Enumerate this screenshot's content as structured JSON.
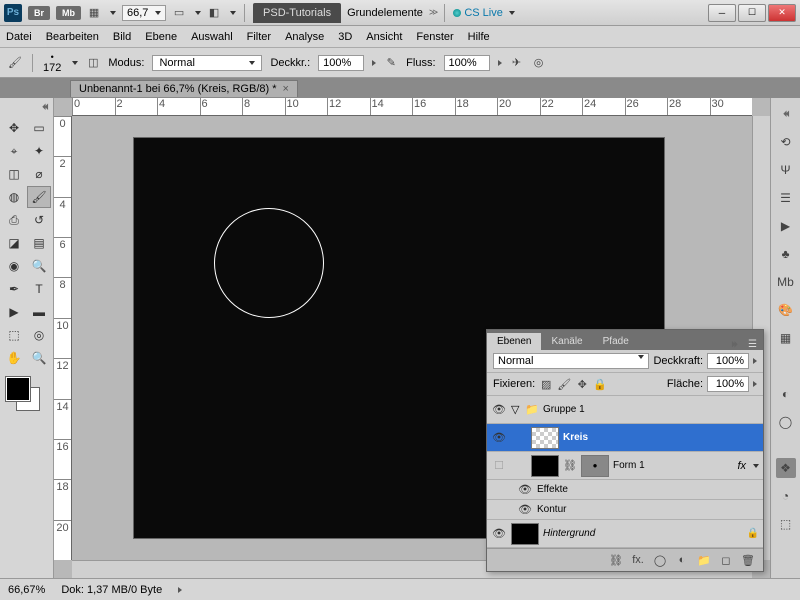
{
  "titlebar": {
    "ps": "Ps",
    "br": "Br",
    "mb": "Mb",
    "zoom": "66,7",
    "workspace1": "PSD-Tutorials",
    "workspace2": "Grundelemente",
    "cslive": "CS Live"
  },
  "menu": [
    "Datei",
    "Bearbeiten",
    "Bild",
    "Ebene",
    "Auswahl",
    "Filter",
    "Analyse",
    "3D",
    "Ansicht",
    "Fenster",
    "Hilfe"
  ],
  "options": {
    "brush_size": "172",
    "mode_label": "Modus:",
    "mode_value": "Normal",
    "opacity_label": "Deckkr.:",
    "opacity_value": "100%",
    "flow_label": "Fluss:",
    "flow_value": "100%"
  },
  "doc_tab": "Unbenannt-1 bei 66,7% (Kreis, RGB/8) *",
  "ruler_h": [
    "0",
    "2",
    "4",
    "6",
    "8",
    "10",
    "12",
    "14",
    "16",
    "18",
    "20",
    "22",
    "24",
    "26",
    "28",
    "30"
  ],
  "ruler_v": [
    "0",
    "2",
    "4",
    "6",
    "8",
    "10",
    "12",
    "14",
    "16",
    "18",
    "20"
  ],
  "status": {
    "zoom": "66,67%",
    "doc": "Dok: 1,37 MB/0 Byte"
  },
  "panel": {
    "tabs": [
      "Ebenen",
      "Kanäle",
      "Pfade"
    ],
    "blend": "Normal",
    "opacity_label": "Deckkraft:",
    "opacity": "100%",
    "lock_label": "Fixieren:",
    "fill_label": "Fläche:",
    "fill": "100%",
    "group": "Gruppe 1",
    "layer_kreis": "Kreis",
    "layer_form": "Form 1",
    "fx": "fx",
    "effects": "Effekte",
    "kontur": "Kontur",
    "background": "Hintergrund"
  }
}
